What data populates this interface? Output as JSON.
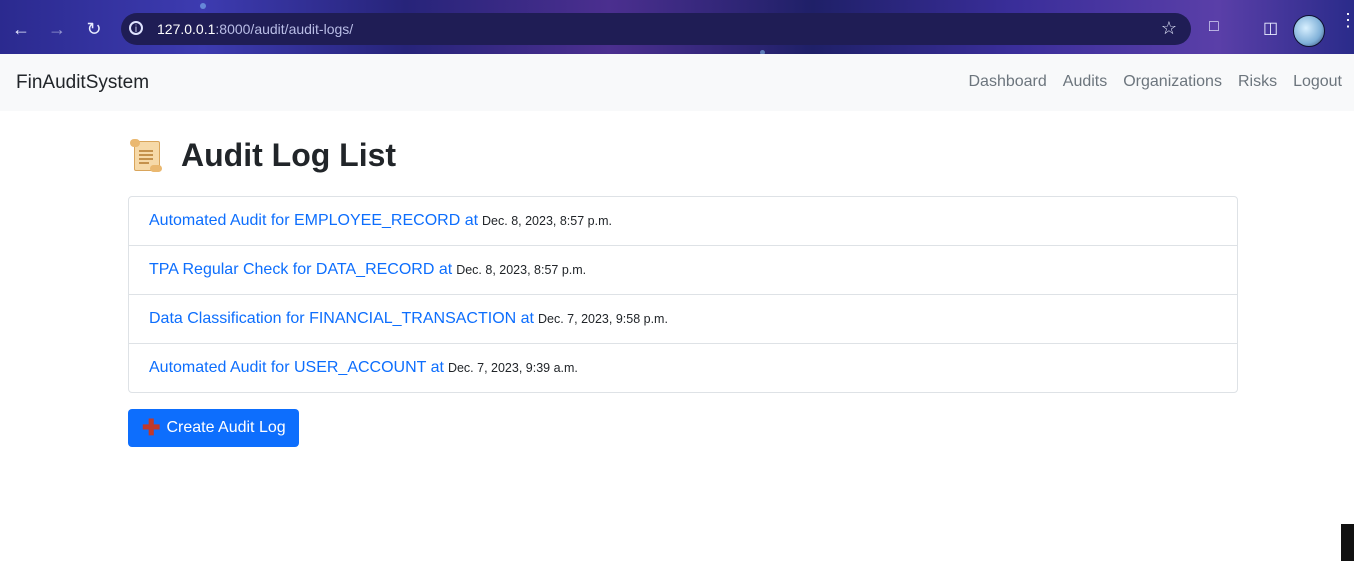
{
  "browser": {
    "url_host": "127.0.0.1",
    "url_rest": ":8000/audit/audit-logs/"
  },
  "navbar": {
    "brand": "FinAuditSystem",
    "links": [
      "Dashboard",
      "Audits",
      "Organizations",
      "Risks",
      "Logout"
    ]
  },
  "main": {
    "title": "Audit Log List",
    "logs": [
      {
        "text": "Automated Audit for EMPLOYEE_RECORD at",
        "time": "Dec. 8, 2023, 8:57 p.m."
      },
      {
        "text": "TPA Regular Check for DATA_RECORD at",
        "time": "Dec. 8, 2023, 8:57 p.m."
      },
      {
        "text": "Data Classification for FINANCIAL_TRANSACTION at",
        "time": "Dec. 7, 2023, 9:58 p.m."
      },
      {
        "text": "Automated Audit for USER_ACCOUNT at",
        "time": "Dec. 7, 2023, 9:39 a.m."
      }
    ],
    "create_button": "Create Audit Log"
  },
  "colors": {
    "link": "#0d6efd",
    "button": "#0d6efd",
    "navbar_bg": "#f8f9fa"
  }
}
